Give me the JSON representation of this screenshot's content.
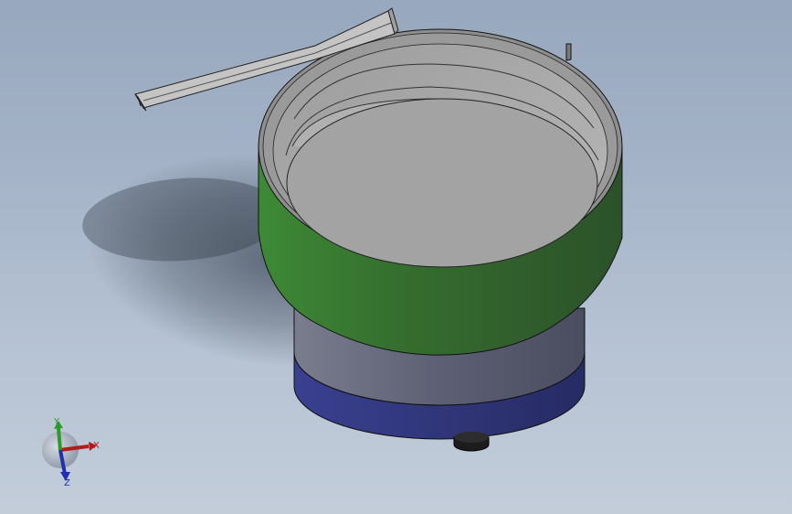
{
  "viewport": {
    "background_top": "#97a7bd",
    "background_bottom": "#c3cdda"
  },
  "model": {
    "bowl_color": "#376e35",
    "bowl_inner_color": "#a3a3a3",
    "rim_color": "#8c8c8c",
    "drive_color": "#5a5d72",
    "base_color": "#303679",
    "foot_color": "#1f1f1f",
    "track_color": "#a9a9a9"
  },
  "triad": {
    "x_label": "X",
    "y_label": "Y",
    "z_label": "Z",
    "x_color": "#b01c1c",
    "y_color": "#2a9a2a",
    "z_color": "#1f2fb0"
  }
}
